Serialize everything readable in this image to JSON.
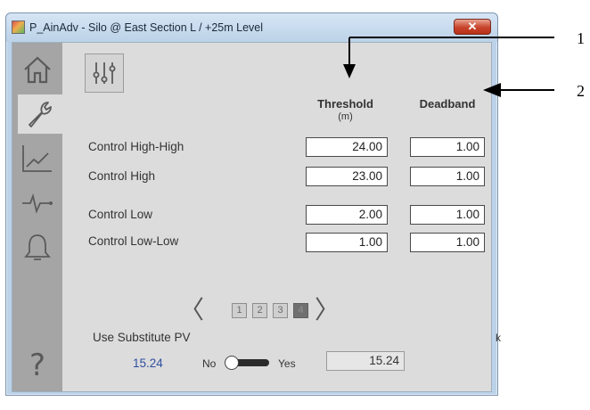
{
  "window": {
    "title": "P_AinAdv - Silo @ East Section L / +25m Level",
    "close_glyph": "✕"
  },
  "sidebar": {
    "items": [
      {
        "icon": "home-icon"
      },
      {
        "icon": "wrench-icon",
        "active": true
      },
      {
        "icon": "trend-icon"
      },
      {
        "icon": "pulse-icon"
      },
      {
        "icon": "bell-icon"
      },
      {
        "icon": "help-icon",
        "glyph": "?"
      }
    ]
  },
  "table": {
    "threshold_header": "Threshold",
    "threshold_unit": "(m)",
    "deadband_header": "Deadband",
    "rows": [
      {
        "label": "Control High-High",
        "threshold": "24.00",
        "deadband": "1.00"
      },
      {
        "label": "Control High",
        "threshold": "23.00",
        "deadband": "1.00"
      },
      {
        "label": "Control Low",
        "threshold": "2.00",
        "deadband": "1.00"
      },
      {
        "label": "Control Low-Low",
        "threshold": "1.00",
        "deadband": "1.00"
      }
    ]
  },
  "pager": {
    "prev": "〈",
    "next": "〉",
    "pages": [
      "1",
      "2",
      "3",
      "4"
    ],
    "current_page": "4"
  },
  "substitute": {
    "label": "Use Substitute PV",
    "pv_value": "15.24",
    "no_label": "No",
    "yes_label": "Yes",
    "toggle_state": "No",
    "substitute_value": "15.24"
  },
  "callouts": [
    "1",
    "2"
  ],
  "stray_glyph": "k",
  "colors": {
    "pv_value": "#2f4fa0",
    "active_page": "#707070",
    "close_button": "#c8432b"
  }
}
